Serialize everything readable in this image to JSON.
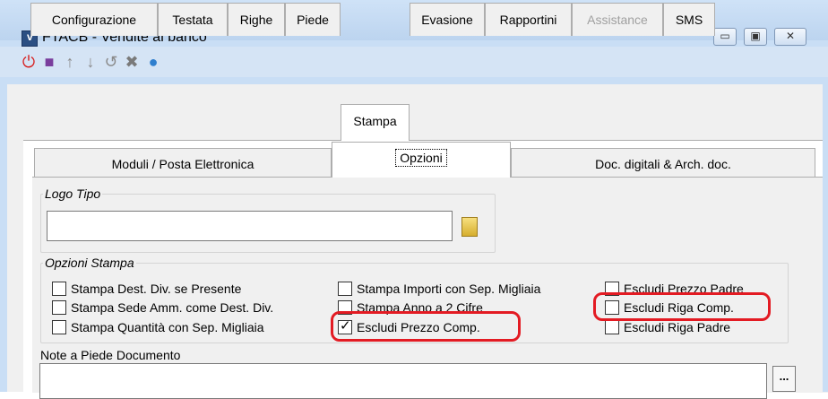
{
  "window": {
    "title": "FTACB - Vendite al banco",
    "controls": {
      "minimize": "▭",
      "maximize": "▣",
      "close": "✕"
    }
  },
  "toolbar": {
    "icons": [
      "power-icon",
      "save-icon",
      "arrow-up-icon",
      "arrow-down-icon",
      "undo-icon",
      "delete-icon",
      "globe-icon"
    ]
  },
  "tabs": [
    {
      "label": "Configurazione"
    },
    {
      "label": "Testata"
    },
    {
      "label": "Righe"
    },
    {
      "label": "Piede"
    },
    {
      "label": "Stampa",
      "active": true
    },
    {
      "label": "Evasione"
    },
    {
      "label": "Rapportini"
    },
    {
      "label": "Assistance",
      "disabled": true
    },
    {
      "label": "SMS"
    }
  ],
  "subtabs": [
    {
      "label": "Moduli / Posta Elettronica"
    },
    {
      "label": "Opzioni",
      "active": true
    },
    {
      "label": "Doc. digitali & Arch. doc."
    }
  ],
  "logo": {
    "legend": "Logo Tipo",
    "value": ""
  },
  "print_options": {
    "legend": "Opzioni Stampa",
    "items": [
      {
        "label": "Stampa Dest. Div. se Presente",
        "checked": false
      },
      {
        "label": "Stampa Sede Amm. come Dest. Div.",
        "checked": false
      },
      {
        "label": "Stampa Quantità con Sep. Migliaia",
        "checked": false
      },
      {
        "label": "Stampa Importi con Sep. Migliaia",
        "checked": false
      },
      {
        "label": "Stampa Anno a 2 Cifre",
        "checked": false
      },
      {
        "label": "Escludi Prezzo Comp.",
        "checked": true
      },
      {
        "label": "Escludi Prezzo Padre",
        "checked": false
      },
      {
        "label": "Escludi Riga Comp.",
        "checked": false
      },
      {
        "label": "Escludi Riga Padre",
        "checked": false
      }
    ]
  },
  "notes": {
    "label": "Note a Piede Documento",
    "value": "",
    "button": "..."
  },
  "colors": {
    "highlight": "#e31b23",
    "frame": "#c9def5"
  }
}
